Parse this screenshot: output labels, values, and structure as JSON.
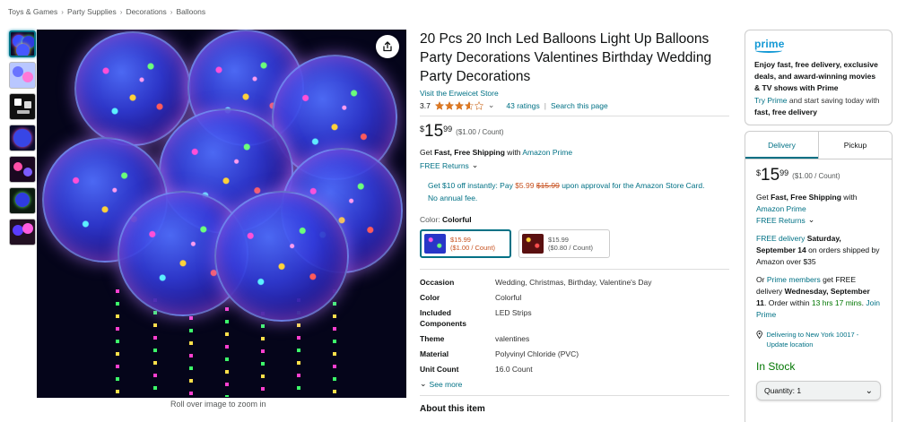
{
  "breadcrumb": [
    "Toys & Games",
    "Party Supplies",
    "Decorations",
    "Balloons"
  ],
  "gallery": {
    "thumbnail_count": 7,
    "zoom_hint": "Roll over image to zoom in"
  },
  "product": {
    "title": "20 Pcs 20 Inch Led Balloons Light Up Balloons Party Decorations Valentines Birthday Wedding Party Decorations",
    "store_link": "Visit the Erweicet Store",
    "rating_value": "3.7",
    "rating_stars": 3.7,
    "ratings_count": "43 ratings",
    "search_link": "Search this page",
    "price": {
      "symbol": "$",
      "whole": "15",
      "fraction": "99",
      "per_unit": "($1.00 / Count)"
    },
    "shipping": {
      "prefix": "Get ",
      "bold": "Fast, Free Shipping",
      "suffix": " with ",
      "link": "Amazon Prime"
    },
    "returns": "FREE Returns",
    "promo": {
      "text1": "Get $10 off instantly: Pay ",
      "new_price": "$5.99",
      "old_price": "$15.99",
      "text2": " upon approval for the Amazon Store Card.",
      "text3": "No annual fee."
    },
    "color": {
      "label": "Color: ",
      "value": "Colorful"
    },
    "swatches": [
      {
        "price": "$15.99",
        "unit": "($1.00 / Count)"
      },
      {
        "price": "$15.99",
        "unit": "($0.80 / Count)"
      }
    ],
    "specs": [
      {
        "key": "Occasion",
        "value": "Wedding, Christmas, Birthday, Valentine's Day"
      },
      {
        "key": "Color",
        "value": "Colorful"
      },
      {
        "key": "Included Components",
        "value": "LED Strips"
      },
      {
        "key": "Theme",
        "value": "valentines"
      },
      {
        "key": "Material",
        "value": "Polyvinyl Chloride (PVC)"
      },
      {
        "key": "Unit Count",
        "value": "16.0 Count"
      }
    ],
    "see_more": "See more",
    "about_heading": "About this item"
  },
  "prime_box": {
    "logo": "prime",
    "headline": "Enjoy fast, free delivery, exclusive deals, and award-winning movies & TV shows with Prime",
    "body_prefix": "Try Prime",
    "body_mid": " and start saving today with ",
    "body_bold": "fast, free delivery"
  },
  "buy_box": {
    "tabs": [
      "Delivery",
      "Pickup"
    ],
    "price": {
      "symbol": "$",
      "whole": "15",
      "fraction": "99",
      "per_unit": "($1.00 / Count)"
    },
    "ship_prefix": "Get ",
    "ship_bold": "Fast, Free Shipping",
    "ship_suffix": " with",
    "ship_link": "Amazon Prime",
    "returns": "FREE Returns",
    "free_delivery_link": "FREE delivery",
    "free_delivery_date": " Saturday, September 14",
    "free_delivery_suffix": " on orders shipped by Amazon over $35",
    "prime_or": "Or ",
    "prime_link": "Prime members",
    "prime_text": " get FREE delivery ",
    "prime_date": "Wednesday, September 11",
    "prime_within": ". Order within ",
    "prime_countdown": "13 hrs 17 mins",
    "prime_join": "Join Prime",
    "deliver_to": "Delivering to New York 10017 - Update location",
    "stock": "In Stock",
    "quantity": "Quantity: 1"
  },
  "colors": {
    "link": "#007185",
    "stock": "#007600",
    "prime": "#1399d5",
    "promo_red": "#c7511f"
  }
}
